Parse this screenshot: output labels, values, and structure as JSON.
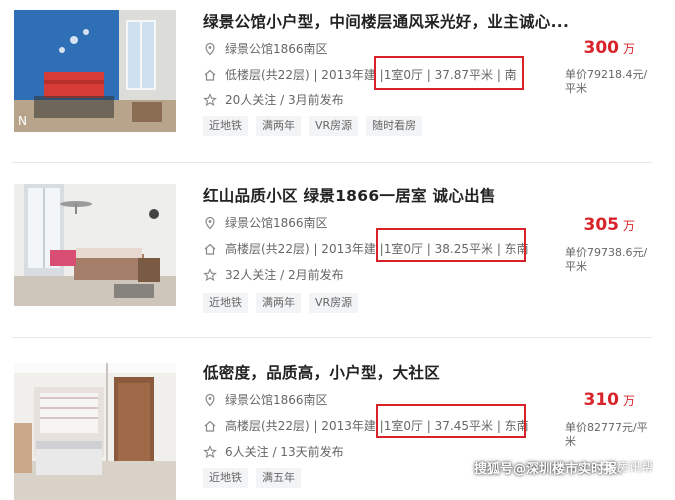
{
  "listings": [
    {
      "title": "绿景公馆小户型，中间楼层通风采光好，业主诚心...",
      "community": "绿景公馆1866南区",
      "floor_info": "低楼层(共22层) | 2013年建 | ",
      "layout_info": "1室0厅 | 37.87平米 | 南",
      "follow": "20人关注 / 3月前发布",
      "tags": [
        "近地铁",
        "满两年",
        "VR房源",
        "随时看房"
      ],
      "price": "300",
      "price_unit": "万",
      "unit_price": "单价79218.4元/平米"
    },
    {
      "title": "红山品质小区 绿景1866一居室 诚心出售",
      "community": "绿景公馆1866南区",
      "floor_info": "高楼层(共22层) | 2013年建 | ",
      "layout_info": "1室0厅 | 38.25平米 | 东南",
      "follow": "32人关注 / 2月前发布",
      "tags": [
        "近地铁",
        "满两年",
        "VR房源"
      ],
      "price": "305",
      "price_unit": "万",
      "unit_price": "单价79738.6元/平米"
    },
    {
      "title": "低密度，品质高，小户型，大社区",
      "community": "绿景公馆1866南区",
      "floor_info": "高楼层(共22层) | 2013年建 | ",
      "layout_info": "1室0厅 | 37.45平米 | 东南",
      "follow": "6人关注 / 13天前发布",
      "tags": [
        "近地铁",
        "满五年"
      ],
      "price": "310",
      "price_unit": "万",
      "unit_price": "单价82777元/平米"
    }
  ],
  "watermark": {
    "text": "搜狐号@深圳楼市实时报、",
    "logo_text": "房讯帮"
  },
  "icons": {
    "location": "location-pin-icon",
    "house": "house-icon",
    "star": "star-icon"
  },
  "colors": {
    "price": "#d9232b",
    "highlight_box": "#d9232b"
  }
}
